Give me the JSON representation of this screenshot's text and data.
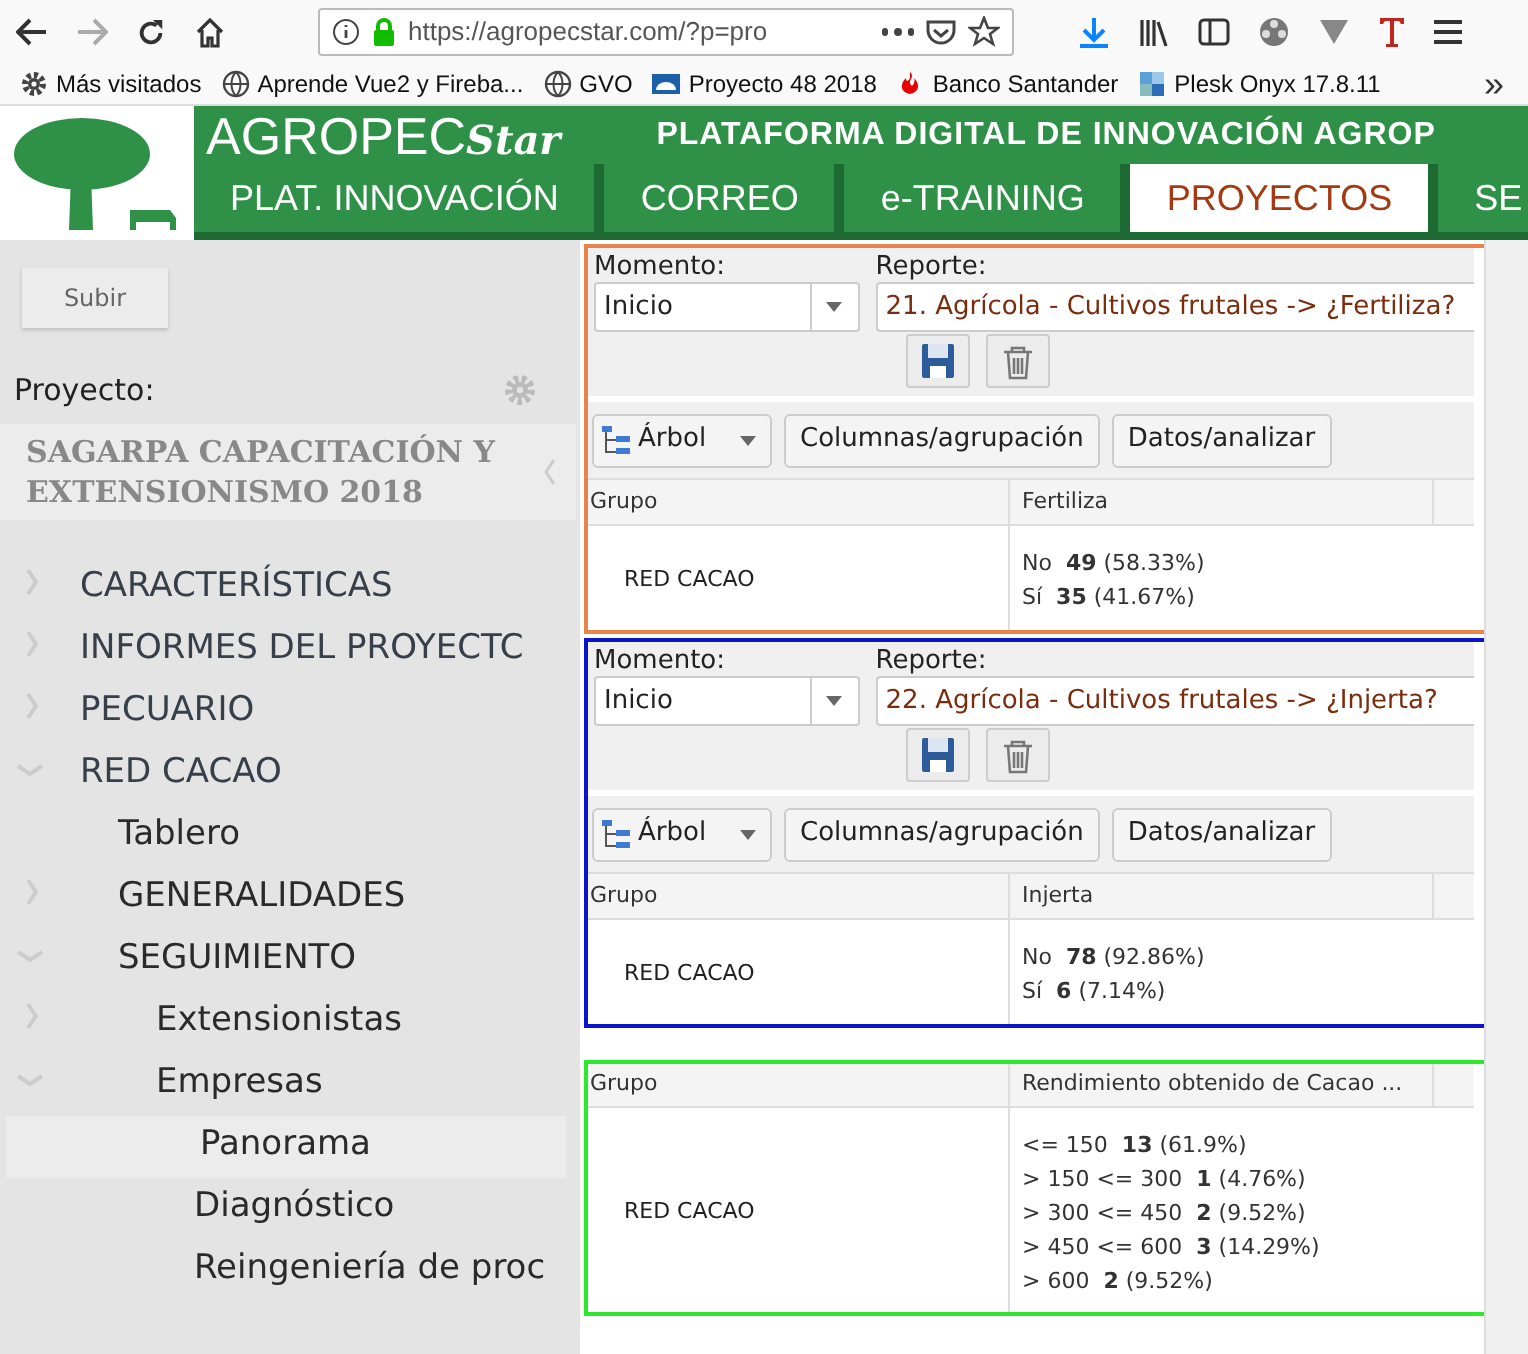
{
  "browser": {
    "url": "https://agropecstar.com/?p=pro",
    "bookmarks": [
      {
        "label": "Más visitados"
      },
      {
        "label": "Aprende Vue2 y Fireba..."
      },
      {
        "label": "GVO"
      },
      {
        "label": "Proyecto 48 2018"
      },
      {
        "label": "Banco Santander"
      },
      {
        "label": "Plesk Onyx 17.8.11"
      }
    ],
    "overflow": "»"
  },
  "header": {
    "brand": "AGROPEC",
    "brand_suffix": "Star",
    "title": "PLATAFORMA DIGITAL DE INNOVACIÓN AGROP",
    "tabs": [
      {
        "label": "PLAT. INNOVACIÓN",
        "selected": false
      },
      {
        "label": "CORREO",
        "selected": false
      },
      {
        "label": "e-TRAINING",
        "selected": false
      },
      {
        "label": "PROYECTOS",
        "selected": true
      },
      {
        "label": "SE",
        "selected": false
      }
    ]
  },
  "sidebar": {
    "up_button": "Subir",
    "project_label": "Proyecto:",
    "project": "SAGARPA CAPACITACIÓN Y EXTENSIONISMO 2018",
    "tree": [
      {
        "label": "CARACTERÍSTICAS",
        "expanded": false,
        "selected": false
      },
      {
        "label": "INFORMES DEL PROYECTC",
        "expanded": false,
        "selected": false
      },
      {
        "label": "PECUARIO",
        "expanded": false,
        "selected": false
      },
      {
        "label": "RED CACAO",
        "expanded": true,
        "selected": false,
        "children": [
          {
            "label": "Tablero",
            "selected": false
          },
          {
            "label": "GENERALIDADES",
            "expanded": false,
            "selected": false
          },
          {
            "label": "SEGUIMIENTO",
            "expanded": true,
            "selected": false,
            "children": [
              {
                "label": "Extensionistas",
                "expanded": false,
                "selected": false
              },
              {
                "label": "Empresas",
                "expanded": true,
                "selected": false,
                "children": [
                  {
                    "label": "Panorama",
                    "selected": true
                  },
                  {
                    "label": "Diagnóstico",
                    "selected": false
                  },
                  {
                    "label": "Reingeniería de proc",
                    "selected": false
                  }
                ]
              }
            ]
          }
        ]
      }
    ]
  },
  "panels": [
    {
      "color": "#e8834a",
      "moment_label": "Momento:",
      "moment": "Inicio",
      "report_label": "Reporte:",
      "report": "21. Agrícola - Cultivos frutales -> ¿Fertiliza?",
      "view_button": "Árbol",
      "columns_button": "Columnas/agrupación",
      "data_button": "Datos/analizar",
      "columns": [
        "Grupo",
        "Fertiliza"
      ],
      "group": "RED CACAO",
      "values": [
        "No  **49** (58.33%)",
        "Sí  **35** (41.67%)"
      ]
    },
    {
      "color": "#0a14c8",
      "moment_label": "Momento:",
      "moment": "Inicio",
      "report_label": "Reporte:",
      "report": "22. Agrícola - Cultivos frutales -> ¿Injerta?",
      "view_button": "Árbol",
      "columns_button": "Columnas/agrupación",
      "data_button": "Datos/analizar",
      "columns": [
        "Grupo",
        "Injerta"
      ],
      "group": "RED CACAO",
      "values": [
        "No  **78** (92.86%)",
        "Sí  **6** (7.14%)"
      ]
    },
    {
      "color": "#2ee82e",
      "columns": [
        "Grupo",
        "Rendimiento obtenido de Cacao ..."
      ],
      "group": "RED CACAO",
      "values": [
        "<= 150  **13** (61.9%)",
        "> 150 <= 300  **1** (4.76%)",
        "> 300 <= 450  **2** (9.52%)",
        "> 450 <= 600  **3** (14.29%)",
        "> 600  **2** (9.52%)"
      ]
    }
  ]
}
